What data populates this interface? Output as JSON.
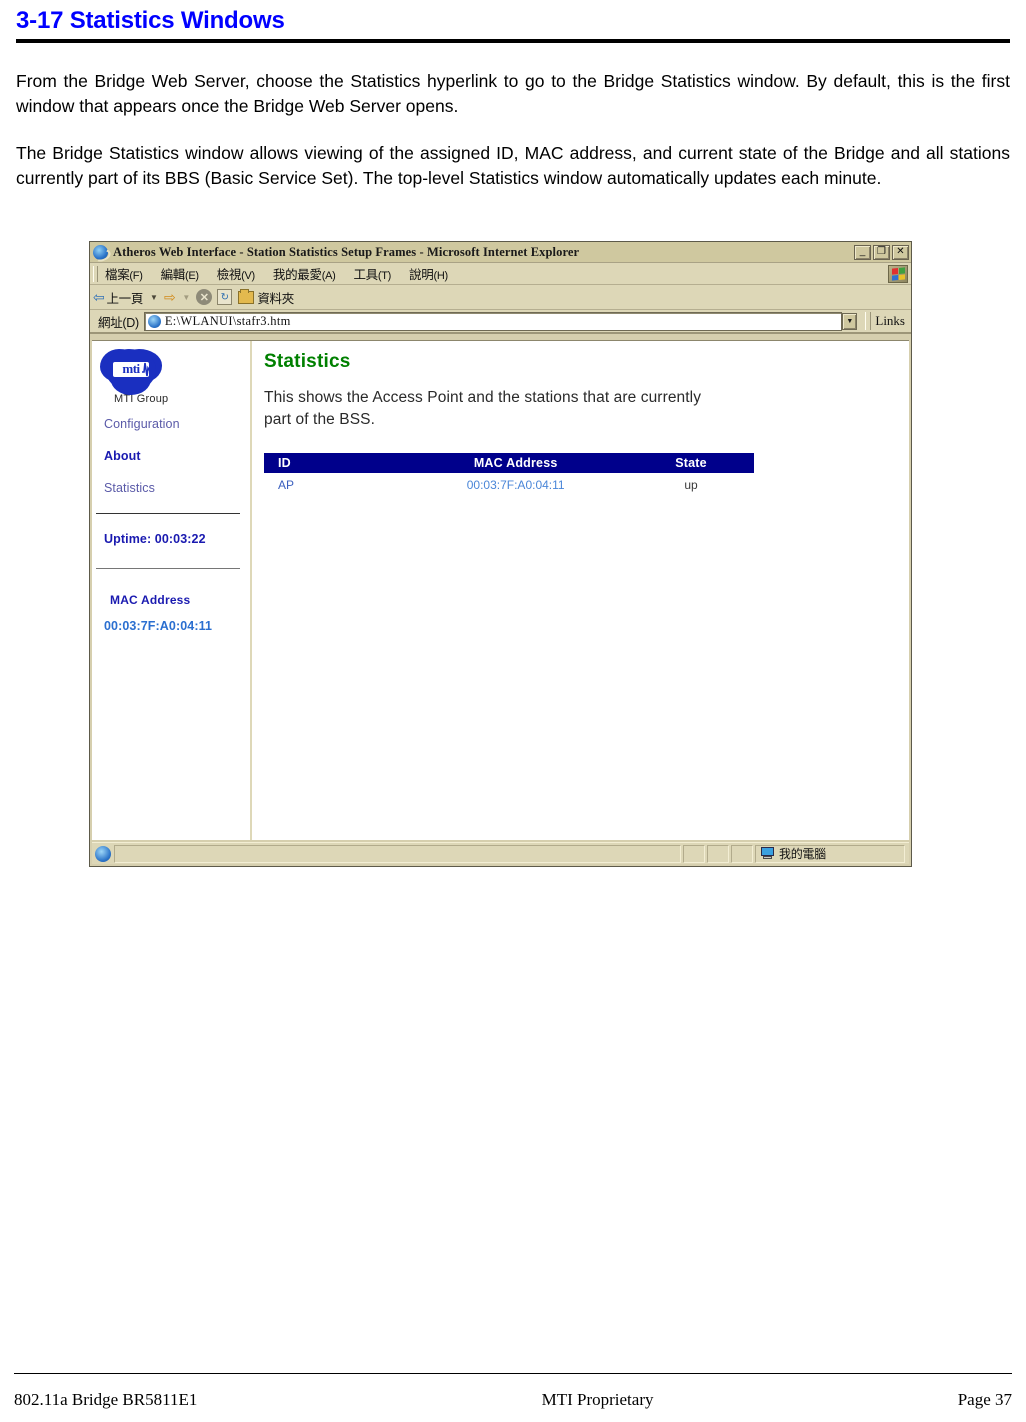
{
  "document": {
    "heading": "3-17 Statistics Windows",
    "paragraphs": [
      "From the Bridge Web Server, choose the Statistics hyperlink to go to the Bridge Statistics window. By default, this is the first window that appears once the Bridge Web Server opens.",
      "The Bridge Statistics window allows viewing of the assigned ID, MAC address, and current state of the Bridge and all stations currently part of its BBS (Basic Service Set). The top-level Statistics window automatically updates each minute."
    ],
    "footer": {
      "left": "802.11a Bridge BR5811E1",
      "center": "MTI Proprietary",
      "right": "Page 37"
    },
    "colors": {
      "heading": "#0000FF",
      "rule": "#000000"
    }
  },
  "browser": {
    "title": "Atheros Web Interface - Station Statistics Setup Frames - Microsoft Internet Explorer",
    "title_icon": "ie-icon",
    "window_buttons": [
      {
        "name": "minimize",
        "glyph": "_"
      },
      {
        "name": "restore",
        "glyph": "❐"
      },
      {
        "name": "close",
        "glyph": "✕"
      }
    ],
    "menu": [
      {
        "label": "檔案",
        "mnemonic": "(F)"
      },
      {
        "label": "編輯",
        "mnemonic": "(E)"
      },
      {
        "label": "檢視",
        "mnemonic": "(V)"
      },
      {
        "label": "我的最愛",
        "mnemonic": "(A)"
      },
      {
        "label": "工具",
        "mnemonic": "(T)"
      },
      {
        "label": "說明",
        "mnemonic": "(H)"
      }
    ],
    "toolbar": {
      "back_label": "上一頁",
      "back_icon": "arrow-left-icon",
      "forward_icon": "arrow-right-icon",
      "stop_icon": "stop-icon",
      "stop_glyph": "✕",
      "refresh_icon": "refresh-icon",
      "refresh_glyph": "↻",
      "folders_label": "資料夾",
      "folders_icon": "folder-icon"
    },
    "address": {
      "label": "網址(D)",
      "url": "E:\\WLANUI\\stafr3.htm",
      "dropdown_icon": "chevron-down-icon",
      "links_label": "Links"
    },
    "statusbar": {
      "zone_label": "我的電腦",
      "zone_icon": "computer-icon",
      "page_icon": "ie-icon"
    }
  },
  "webpage": {
    "sidebar": {
      "logo_text": "mti",
      "logo_caption": "MTI Group",
      "nav": [
        {
          "label": "Configuration",
          "current": false
        },
        {
          "label": "About",
          "current": true
        },
        {
          "label": "Statistics",
          "current": false
        }
      ],
      "uptime": "Uptime: 00:03:22",
      "mac_title": "MAC Address",
      "mac_value": "00:03:7F:A0:04:11"
    },
    "main": {
      "title": "Statistics",
      "description": "This shows the Access Point and the stations that are currently part of the BSS.",
      "table": {
        "headers": [
          "ID",
          "MAC Address",
          "State"
        ],
        "rows": [
          {
            "id": "AP",
            "mac": "00:03:7F:A0:04:11",
            "state": "up"
          }
        ]
      },
      "colors": {
        "title": "#008000",
        "table_header_bg": "#00008B",
        "table_header_text": "#FFFFFF"
      }
    }
  }
}
